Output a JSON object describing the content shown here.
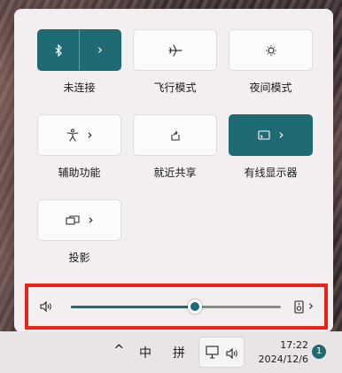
{
  "quick_settings": {
    "tiles": [
      {
        "label": "未连接",
        "icon": "bluetooth-icon",
        "state": "on",
        "has_chevron": true
      },
      {
        "label": "飞行模式",
        "icon": "airplane-icon",
        "state": "off",
        "has_chevron": false
      },
      {
        "label": "夜间模式",
        "icon": "brightness-icon",
        "state": "off",
        "has_chevron": false
      },
      {
        "label": "辅助功能",
        "icon": "accessibility-icon",
        "state": "off",
        "has_chevron": true
      },
      {
        "label": "就近共享",
        "icon": "share-icon",
        "state": "off",
        "has_chevron": false
      },
      {
        "label": "有线显示器",
        "icon": "cast-icon",
        "state": "on",
        "has_chevron": true
      },
      {
        "label": "投影",
        "icon": "project-icon",
        "state": "off",
        "has_chevron": true
      }
    ],
    "volume": {
      "level_fraction": 0.59,
      "speaker_icon": "speaker-icon",
      "output_icon": "audio-output-icon"
    }
  },
  "taskbar": {
    "show_hidden_icons": "^",
    "ime_mode": "中",
    "ime_name": "拼",
    "time": "17:22",
    "date": "2024/12/6",
    "notification_count": "1"
  },
  "colors": {
    "accent": "#1e6b73",
    "highlight": "#e8231a"
  }
}
